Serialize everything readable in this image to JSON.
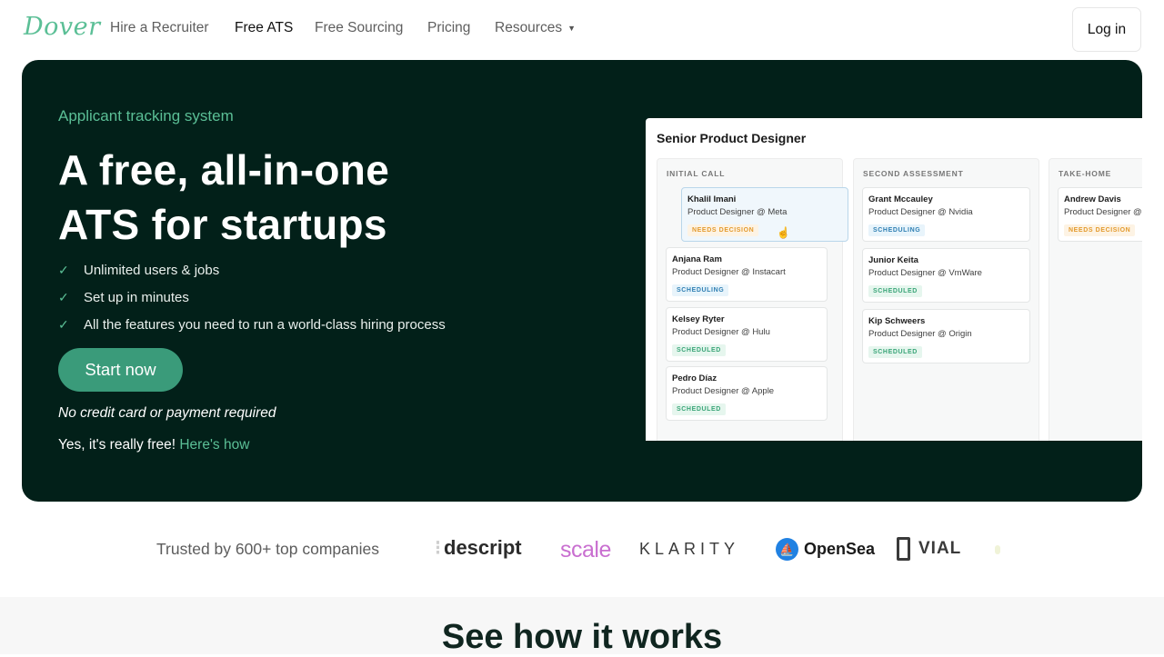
{
  "nav": {
    "logo": "Dover",
    "links": [
      "Hire a Recruiter",
      "Free ATS",
      "Free Sourcing",
      "Pricing",
      "Resources"
    ],
    "login": "Log in"
  },
  "hero": {
    "eyebrow": "Applicant tracking system",
    "headline_1": "A free, all-in-one",
    "headline_2": "ATS for startups",
    "features": [
      "Unlimited users & jobs",
      "Set up in minutes",
      "All the features you need to run a world-class hiring process"
    ],
    "cta": "Start now",
    "no_card": "No credit card or payment required",
    "free_text": "Yes, it's really free!",
    "free_link": "Here's how"
  },
  "board": {
    "title": "Senior Product Designer",
    "columns": [
      {
        "title": "INITIAL CALL",
        "cards": [
          {
            "name": "Khalil Imani",
            "role": "Product Designer @ Meta",
            "status": "NEEDS DECISION"
          },
          {
            "name": "Anjana Ram",
            "role": "Product Designer @ Instacart",
            "status": "SCHEDULING"
          },
          {
            "name": "Kelsey Ryter",
            "role": "Product Designer @ Hulu",
            "status": "SCHEDULED"
          },
          {
            "name": "Pedro Díaz",
            "role": "Product Designer @ Apple",
            "status": "SCHEDULED"
          }
        ]
      },
      {
        "title": "SECOND ASSESSMENT",
        "cards": [
          {
            "name": "Grant Mccauley",
            "role": "Product Designer @ Nvidia",
            "status": "SCHEDULING"
          },
          {
            "name": "Junior Keita",
            "role": "Product Designer @ VmWare",
            "status": "SCHEDULED"
          },
          {
            "name": "Kip Schweers",
            "role": "Product Designer @ Origin",
            "status": "SCHEDULED"
          }
        ]
      },
      {
        "title": "TAKE-HOME",
        "cards": [
          {
            "name": "Andrew Davis",
            "role": "Product Designer @ Figma",
            "status": "NEEDS DECISION"
          }
        ]
      }
    ]
  },
  "trusted": {
    "text": "Trusted by 600+ top companies",
    "logos": [
      "descript",
      "scale",
      "KLARITY",
      "OpenSea",
      "VIAL"
    ]
  },
  "section": {
    "title": "See how it works"
  },
  "colors": {
    "hero_bg": "#022019",
    "accent": "#5bbf96",
    "cta": "#3a9b7a"
  }
}
